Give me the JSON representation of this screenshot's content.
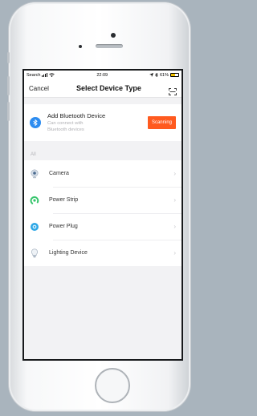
{
  "status_bar": {
    "carrier": "Search",
    "time": "22:09",
    "battery": "61%"
  },
  "nav": {
    "cancel_label": "Cancel",
    "title": "Select Device Type"
  },
  "bluetooth": {
    "title": "Add Bluetooth Device",
    "subtitle_line1": "Can connect with",
    "subtitle_line2": "Bluetooth devices",
    "scan_label": "Scanning",
    "accent": "#ff5a1f",
    "icon_color": "#2d8cf0"
  },
  "section_label": "All",
  "devices": [
    {
      "label": "Camera",
      "icon": "camera-icon"
    },
    {
      "label": "Power Strip",
      "icon": "power-strip-icon"
    },
    {
      "label": "Power Plug",
      "icon": "power-plug-icon"
    },
    {
      "label": "Lighting Device",
      "icon": "light-bulb-icon"
    }
  ]
}
